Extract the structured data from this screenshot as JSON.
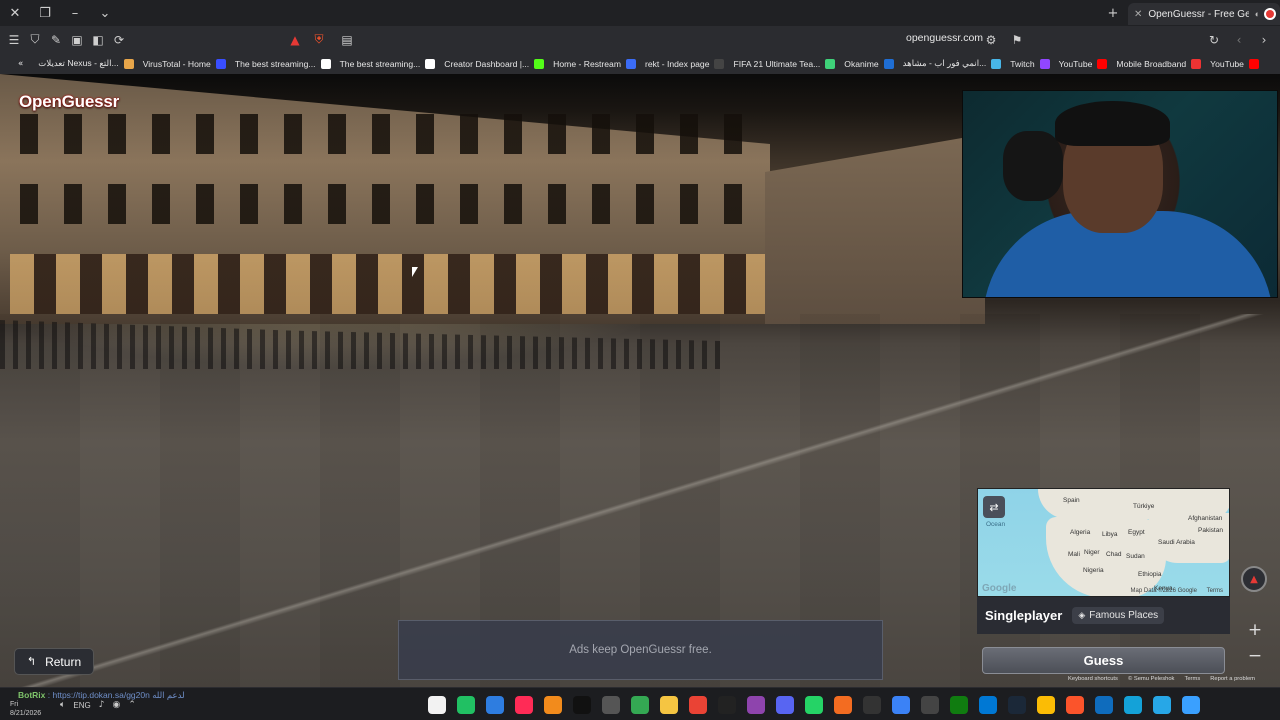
{
  "browser": {
    "tab": {
      "title": "OpenGuessr - Free GeoGuess"
    },
    "url": "openguessr.com",
    "bookmarks": [
      {
        "label": "تعديلات Nexus - التع...",
        "color": "#e8a64a"
      },
      {
        "label": "VirusTotal - Home",
        "color": "#394eff"
      },
      {
        "label": "The best streaming...",
        "color": "#ffffff"
      },
      {
        "label": "The best streaming...",
        "color": "#ffffff"
      },
      {
        "label": "Creator Dashboard |...",
        "color": "#53fc18"
      },
      {
        "label": "Home - Restream",
        "color": "#3b6cf6"
      },
      {
        "label": "rekt - Index page",
        "color": "#444444"
      },
      {
        "label": "FIFA 21 Ultimate Tea...",
        "color": "#3fd27a"
      },
      {
        "label": "Okanime",
        "color": "#1f6ed4"
      },
      {
        "label": "انمي فور اب - مشاهد...",
        "color": "#48b6e8"
      },
      {
        "label": "Twitch",
        "color": "#9146ff"
      },
      {
        "label": "YouTube",
        "color": "#ff0000"
      },
      {
        "label": "Mobile Broadband",
        "color": "#e33"
      },
      {
        "label": "YouTube",
        "color": "#ff0000"
      }
    ]
  },
  "game": {
    "brand": "OpenGuessr",
    "mode": "Singleplayer",
    "category": "Famous Places",
    "guess_label": "Guess",
    "return_label": "Return",
    "ad_text": "Ads keep OpenGuessr free.",
    "minimap": {
      "labels": [
        "Spain",
        "Türkiye",
        "Afghanistan",
        "Pakistan",
        "Algeria",
        "Libya",
        "Egypt",
        "Saudi Arabia",
        "Mali",
        "Niger",
        "Chad",
        "Sudan",
        "Nigeria",
        "Ethiopia",
        "Kenya"
      ],
      "ocean": "Ocean",
      "logo": "Google",
      "data_credit": "Map Data ©2026 Google",
      "terms": "Terms"
    },
    "footer": {
      "shortcuts": "Keyboard shortcuts",
      "credit": "© Semu Peleshok",
      "terms": "Terms",
      "report": "Report a problem"
    }
  },
  "taskbar": {
    "overlay": {
      "name": "BotRix",
      "text": ": https://tip.dokan.sa/gg20n لدعم الله"
    },
    "day": "Fri",
    "date": "8/21/2026",
    "lang": "ENG",
    "apps": [
      {
        "name": "file-app",
        "color": "#f2f2f2"
      },
      {
        "name": "green-app",
        "color": "#21c063"
      },
      {
        "name": "blue-app",
        "color": "#2e7de0"
      },
      {
        "name": "tiktok-app",
        "color": "#ff2b56"
      },
      {
        "name": "h-app",
        "color": "#f28b1c"
      },
      {
        "name": "tiktok-app-2",
        "color": "#111111"
      },
      {
        "name": "brush-app",
        "color": "#555555"
      },
      {
        "name": "chrome-app",
        "color": "#34a853"
      },
      {
        "name": "folder-app",
        "color": "#f5c542"
      },
      {
        "name": "chrome-app-2",
        "color": "#ea4335"
      },
      {
        "name": "capcut-app",
        "color": "#222222"
      },
      {
        "name": "purple-app",
        "color": "#8e44ad"
      },
      {
        "name": "discord-app",
        "color": "#5865f2"
      },
      {
        "name": "whatsapp-app",
        "color": "#25d366"
      },
      {
        "name": "orange-app",
        "color": "#f36c21"
      },
      {
        "name": "dark-app",
        "color": "#333333"
      },
      {
        "name": "monitor-app",
        "color": "#3b82f6"
      },
      {
        "name": "obs-app",
        "color": "#444444"
      },
      {
        "name": "xbox-app",
        "color": "#107c10"
      },
      {
        "name": "settings-app",
        "color": "#0078d4"
      },
      {
        "name": "steam-app",
        "color": "#1b2838"
      },
      {
        "name": "chrome-app-3",
        "color": "#fbbc05"
      },
      {
        "name": "brave-app",
        "color": "#fb542b"
      },
      {
        "name": "outlook-app",
        "color": "#0f6cbd"
      },
      {
        "name": "edge-app",
        "color": "#14a2d8"
      },
      {
        "name": "telegram-app",
        "color": "#27a7e7"
      },
      {
        "name": "windows-app",
        "color": "#3aa0ff"
      }
    ]
  }
}
